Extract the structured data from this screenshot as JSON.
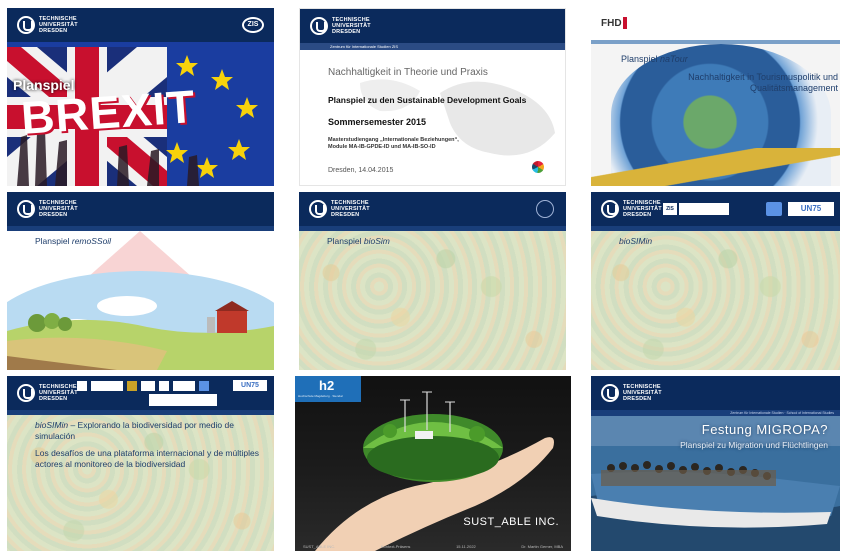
{
  "tiles": [
    {
      "name": "brexit",
      "logo": [
        "TECHNISCHE",
        "UNIVERSITÄT",
        "DRESDEN"
      ],
      "badge": "ZIS",
      "title": "Planspiel",
      "word": "BREXIT",
      "colors": {
        "header": "#0b2a5c",
        "eu": "#1a3da0",
        "red": "#c8102e"
      }
    },
    {
      "name": "sdg",
      "sub": "Zentrum für Internationale Studien ZIS",
      "heading": "Nachhaltigkeit in Theorie und Praxis",
      "title": "Planspiel zu den Sustainable Development Goals",
      "semester": "Sommersemester 2015",
      "line1": "Masterstudiengang „Internationale Beziehungen“,",
      "line2": "Module MA-IB-GPDE-ID und MA-IB-SO-ID",
      "date": "Dresden, 14.04.2015"
    },
    {
      "name": "natour",
      "logo": "FHD",
      "title_prefix": "Planspiel ",
      "title_italic": "naTour",
      "subtitle": "Nachhaltigkeit in Tourismuspolitik und Qualitätsmanagement"
    },
    {
      "name": "remossoil",
      "logo": [
        "TECHNISCHE",
        "UNIVERSITÄT",
        "DRESDEN"
      ],
      "title_prefix": "Planspiel ",
      "title_italic": "remoSSoil"
    },
    {
      "name": "biosim",
      "logo": [
        "TECHNISCHE",
        "UNIVERSITÄT",
        "DRESDEN"
      ],
      "title_prefix": "Planspiel ",
      "title_italic": "bioSim"
    },
    {
      "name": "biosimin",
      "logo": [
        "TECHNISCHE",
        "UNIVERSITÄT",
        "DRESDEN"
      ],
      "title_italic": "bioSIMin",
      "badge1": "ZIS",
      "badge2": "UN75"
    },
    {
      "name": "biosimin-es",
      "logo": [
        "TECHNISCHE",
        "UNIVERSITÄT",
        "DRESDEN"
      ],
      "title_italic": "bioSIMin",
      "title_rest": " – Explorando la biodiversidad por medio de simulación",
      "body": "Los desafíos de una plataforma internacional y de múltiples actores al monitoreo de la biodiversidad",
      "badge": "UN75"
    },
    {
      "name": "sustable",
      "logo": "h2",
      "logo_sub": "Hochschule Magdeburg · Stendal",
      "brand": "SUST_ABLE INC.",
      "footer_left": "SUST_ABLE INC.",
      "footer_mid": "Kontext-Präsens",
      "footer_date": "15.11.2022",
      "footer_right": "Dr. Martin Gerner, MBA"
    },
    {
      "name": "migropa",
      "logo": [
        "TECHNISCHE",
        "UNIVERSITÄT",
        "DRESDEN"
      ],
      "sub": "Zentrum für Internationale Studien · School of International Studies",
      "title": "Festung MIGROPA?",
      "subtitle": "Planspiel zu Migration und Flüchtlingen"
    }
  ]
}
